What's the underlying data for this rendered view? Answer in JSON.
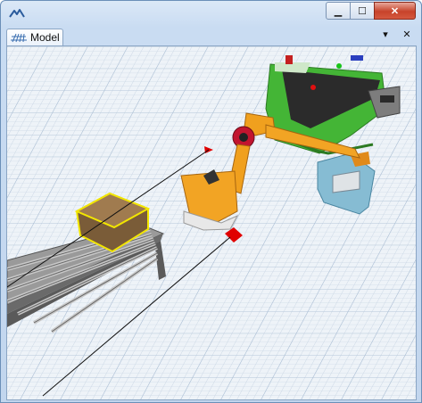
{
  "window": {
    "title": "",
    "controls": {
      "minimize": "minimize",
      "maximize": "maximize",
      "close": "close"
    }
  },
  "tabs": [
    {
      "label": "Model",
      "icon": "grid-icon",
      "active": true
    }
  ],
  "tab_tools": {
    "dropdown_glyph": "▾",
    "close_glyph": "✕"
  },
  "scene": {
    "objects": [
      {
        "name": "roller-conveyor",
        "color": "#8a8a8a"
      },
      {
        "name": "box",
        "color": "#8b6a43",
        "highlight": "#f2e600"
      },
      {
        "name": "robot-arm",
        "color": "#f0a01e"
      },
      {
        "name": "belt-conveyor",
        "color": "#3fae2f"
      },
      {
        "name": "target-marker",
        "color": "#e00000"
      },
      {
        "name": "fixture",
        "color": "#7fb7cf"
      }
    ],
    "grid_color": "#b9c9db",
    "floor_color": "#eef3f8"
  }
}
